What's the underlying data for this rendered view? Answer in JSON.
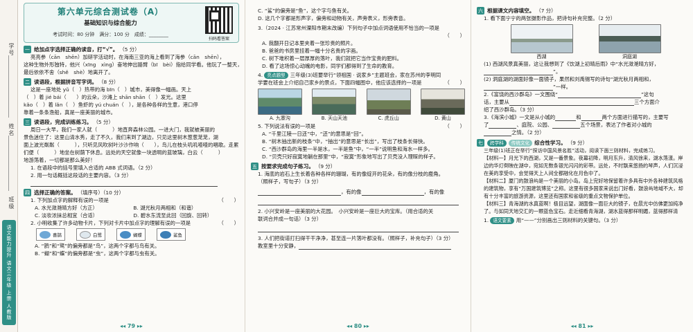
{
  "strip": {
    "fields": [
      "学号",
      "姓名",
      "班级"
    ],
    "tab_label": "语文能力提升 语文三年级 上册 人教版"
  },
  "page1": {
    "header": {
      "title": "第六单元综合测试卷（A）",
      "subtitle": "基础知识与综合能力",
      "meta": "考试时间：80 分钟　满分：100 分　成绩：________",
      "qr_label": "扫码看答案"
    },
    "s1": {
      "num": "一",
      "text": "给加点字选择正确的读音，打“√”。",
      "points": "（5 分）",
      "lines": [
        "亮亮参（cān　shēn）加研学活动时，在海南三亚的海上看到了海参（cān　shēn），",
        "这种生物外形独特，他兴（xīng　xìng）奋地伸出胳臂（bī　bèi）指给同学看。他玩了一整天，",
        "最后依依不舍（shě　shè）地离开了。"
      ]
    },
    "s2": {
      "num": "二",
      "text": "读语段，根据拼音写字词。",
      "points": "（8 分）",
      "lines": [
        "这是一座地处 yǔ（　）热带的海 bīn（　）城市，美得像一幅画。天上",
        "（　）着 jié bái（　　）的云朵，沙滩上 shān shān（　）发光。这里",
        "kǎo（　）着 lǎn（　）鱼虾的 yú chuán（　），是各种各样的生意，港口停",
        "靠着一条条渔船，真是一座美丽的城市。"
      ]
    },
    "s3": {
      "num": "三",
      "text": "读语段，完成训练练习。",
      "points": "（5 分）",
      "passage": [
        "周日一大早，我们一家人就（　　　）地直奔森林公园。一进大门，我就被美丽的",
        "景色迷住了：这里山清水秀，走了不久，我们来到了湖边，只见这里树木葱葱茏茏，湖",
        "面上波光粼粼（　　　），只听见风吹树叶沙沙作响（　　），鸟儿在枝头叽叽喳喳的唱歌。走累了，我",
        "们便（　　　）地坐在树荫下休息。远处的天空就像一块透明的蓝玻璃，白云（　　　）",
        "地游荡着，一切都是那么美好！"
      ],
      "q1": "1. 在语段中的括号里填入合适的 ABB 式词语。（2 分）",
      "q2": "2. 用一句话概括这段话的主要内容。（3 分）"
    },
    "s4": {
      "num": "四",
      "text": "选择正确的答案。",
      "points": "（填序号）（10 分）",
      "q1": "1. 下列加点字的解释有误的一项是",
      "q1_options": [
        [
          "A. 水光潋滟晴方好（方正）",
          "B. 湖光秋月两相和（和谐）"
        ],
        [
          "C. 淡妆浓抹总相宜（合适）",
          "D. 碧水东流至此回（回旋、回转）"
        ]
      ],
      "q2": "2. 小明收集了许多动物卡片，下列对卡片中加点字的理解有误的一项是",
      "cards": [
        "喜鹊",
        "白鹭",
        "蝴蝶",
        "鲨鱼"
      ],
      "q2_options": [
        "A. “鹊”和“鹭”的偏旁都是“鸟”，这两个字都与鸟有关。",
        "B. “蝴”和“蝶”的偏旁都是“虫”，这两个字都与虫有关。"
      ]
    },
    "page_number": "79"
  },
  "page2": {
    "top_lines": [
      "C. “鲨”的偏旁是“鱼”，这个字与鱼有关。",
      "D. 这几个字都是形声字，偏旁和动物有关，声旁表义，形旁表音。"
    ],
    "q3": "3.（2024 · 江苏常州溧阳市期末改编）下列句子中加点词语使用不恰当的一项是",
    "q3_options": [
      "A. 我翻开日记本里夹着一张珍贵的照片。",
      "B. 爸爸的书房里挂着一幅十分名贵的字画。",
      "C. 树下堆积着一层厚厚的落叶，我们就把它当作宝贵的肥料。",
      "D. 看了这场惊心动魄的电影，同学们都得到了生命的教育。"
    ],
    "q4_tag": "亮点题型",
    "q4": "三年级(3)班要举行“领祖国 · 说家乡”主题班会，家在苏州的李明同",
    "q4_cont": "学要在班会上介绍自己家乡的景点，下面四幅图中，他应该选择的一项是",
    "images": [
      "A. 九寨沟",
      "B. 天山天池",
      "C. 虎丘山",
      "D. 黄山"
    ],
    "q5": "5. 下列说法有误的一项是",
    "q5_options": [
      "A. “千里江陵一日还”中，“还”的意思是“回”。",
      "B. “树木抽出新的枝条”中，“抽出”的意思是“长出”，写出了枝条长得快。",
      "C. “西沙群岛的海里一半是水，一半是鱼”中，“一半”说明鱼和海水一样多。",
      "D. “贝壳只好寂寞地躺在那里”中，“寂寞”形象地写出了贝壳没人理睬的样子。"
    ],
    "s5": {
      "num": "五",
      "text": "按要求完成句子练习。",
      "points": "（9 分）"
    },
    "sq1": "1. 海底的岩石上生长着各种各样的珊瑚，有的像绽开的花朵，有的像分枝的鹿角。",
    "sq1_hint": "（照样子，写句子）（3 分）",
    "sq1_fill": [
      "，有的像",
      "，有的像"
    ],
    "sq2": "2. 小兴安岭是一座美丽的大花园。　小兴安岭是一座巨大的宝库。（用合适的关",
    "sq2_hint": "联词合并成一句话）（3 分）",
    "sq3": "3. 人们把街道打扫得干干净净，甚至连一片落叶都没有。（照样子，补充句子）（3 分）",
    "sq3_cont": "教室里十分安静，",
    "page_number": "80"
  },
  "page3": {
    "s6": {
      "num": "六",
      "text": "根据课文内容填空。",
      "points": "（7 分）"
    },
    "q1": "1. 看下面宁宁的两张摄影作品，把诗句补充完整。（2 分）",
    "photos": [
      "西湖",
      "洞庭湖"
    ],
    "q1_a": "(1) 西湖风景真美丽，这让我想到了《饮湖上初晴后雨》中“水光潋滟晴方好，",
    "q1_a_end": "”。",
    "q1_b": "(2) 洞庭湖的湖面好像一面镜子，果然和刘禹锡写的诗句“湖光秋月两相和，",
    "q1_b_end": "”一样。",
    "q2": "2.《富饶的西沙群岛》一文围绕“",
    "q2_mid": "”这句",
    "q2_c": "话，主要从",
    "q2_c2": "三个方面介",
    "q2_d": "绍了西沙群岛。（3 分）",
    "q3": "3.《海滨小城》一文是从小城的",
    "q3_mid": "和",
    "q3_mid2": "两个方面进行描写的，主要写",
    "q3_c": "了",
    "q3_c2": "、庭院、公园、",
    "q3_c3": "五个场景，表达了作者对小城的",
    "q3_d": "之情。（2 分）",
    "s7": {
      "num": "七",
      "tag1": "跨学科",
      "tag2": "传统文化",
      "text": "综合性学习。",
      "points": "（9 分）"
    },
    "intro": "三年级(1)班正在举行“探访中国风景名胜”活动，阅读下面三则材料，完成练习。",
    "materials": [
      "【材料一】月光下的西湖，又是一番景象。夜幕初降，明月东升，清风徐来，湖水荡漾。岸边的华灯倒映在湖中，宛如无数条银光闪闪的彩带。远处，不时飘来悠扬的琴声，人们沉浸在美的享受中，会觉得天上人间全都融化在月色中了。",
      "【材料二】厦门的鼓浪屿是一个美丽的小岛。岛上完好地保留着许多具有中外各种建筑风格的建筑物，享有“万国建筑博览”之称。这里有很多国家来说出门好看，鼓浪屿地域不大，却有十分丰富的旅游资源，这里还有国家和省级的重点文物保护单位。",
      "【材料三】青海湖的水真蓝啊！极目远望，湖面像一面巨大的镜子，在晨光中仿佛更加纯净了。与如同天地交汇的一颗蓝色宝石。走近细看青海湖，湖水蓝得那样明媚，蓝得那样清澈。"
    ],
    "last": "1.",
    "last_tag": "语文要素",
    "last_text": "用“——”分别画出三则材料的关键句。（3 分）",
    "page_number": "81"
  }
}
